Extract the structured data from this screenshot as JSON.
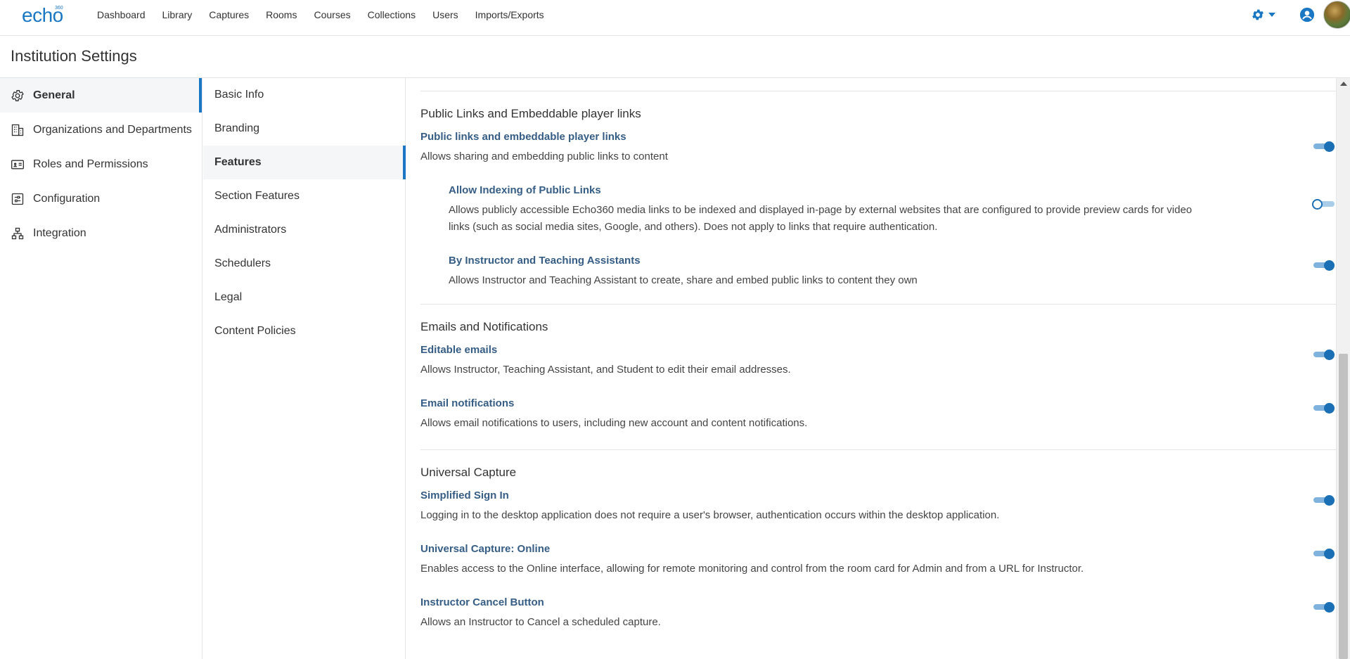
{
  "logo": {
    "text": "echo",
    "superscript": "360"
  },
  "nav": [
    "Dashboard",
    "Library",
    "Captures",
    "Rooms",
    "Courses",
    "Collections",
    "Users",
    "Imports/Exports"
  ],
  "header_icons": [
    "gear-icon",
    "user-circle-icon",
    "avatar"
  ],
  "page_title": "Institution Settings",
  "sidebar": [
    {
      "label": "General",
      "icon": "gear-icon",
      "active": true
    },
    {
      "label": "Organizations and Departments",
      "icon": "building-icon",
      "active": false
    },
    {
      "label": "Roles and Permissions",
      "icon": "id-card-icon",
      "active": false
    },
    {
      "label": "Configuration",
      "icon": "sliders-icon",
      "active": false
    },
    {
      "label": "Integration",
      "icon": "network-icon",
      "active": false
    }
  ],
  "submenu": [
    {
      "label": "Basic Info",
      "active": false
    },
    {
      "label": "Branding",
      "active": false
    },
    {
      "label": "Features",
      "active": true
    },
    {
      "label": "Section Features",
      "active": false
    },
    {
      "label": "Administrators",
      "active": false
    },
    {
      "label": "Schedulers",
      "active": false
    },
    {
      "label": "Legal",
      "active": false
    },
    {
      "label": "Content Policies",
      "active": false
    }
  ],
  "sections": [
    {
      "title": "Public Links and Embeddable player links",
      "settings": [
        {
          "name": "Public links and embeddable player links",
          "desc": "Allows sharing and embedding public links to content",
          "enabled": true,
          "indent": false
        },
        {
          "name": "Allow Indexing of Public Links",
          "desc": "Allows publicly accessible Echo360 media links to be indexed and displayed in-page by external websites that are configured to provide preview cards for video links (such as social media sites, Google, and others). Does not apply to links that require authentication.",
          "enabled": false,
          "indent": true
        },
        {
          "name": "By Instructor and Teaching Assistants",
          "desc": "Allows Instructor and Teaching Assistant to create, share and embed public links to content they own",
          "enabled": true,
          "indent": true
        }
      ]
    },
    {
      "title": "Emails and Notifications",
      "settings": [
        {
          "name": "Editable emails",
          "desc": "Allows Instructor, Teaching Assistant, and Student to edit their email addresses.",
          "enabled": true,
          "indent": false
        },
        {
          "name": "Email notifications",
          "desc": "Allows email notifications to users, including new account and content notifications.",
          "enabled": true,
          "indent": false
        }
      ]
    },
    {
      "title": "Universal Capture",
      "settings": [
        {
          "name": "Simplified Sign In",
          "desc": "Logging in to the desktop application does not require a user's browser, authentication occurs within the desktop application.",
          "enabled": true,
          "indent": false
        },
        {
          "name": "Universal Capture: Online",
          "desc": "Enables access to the Online interface, allowing for remote monitoring and control from the room card for Admin and from a URL for Instructor.",
          "enabled": true,
          "indent": false
        },
        {
          "name": "Instructor Cancel Button",
          "desc": "Allows an Instructor to Cancel a scheduled capture.",
          "enabled": true,
          "indent": false
        }
      ]
    }
  ],
  "colors": {
    "accent": "#1a77c4",
    "setting_name": "#355d85",
    "toggle_track": "#7fb3de"
  }
}
